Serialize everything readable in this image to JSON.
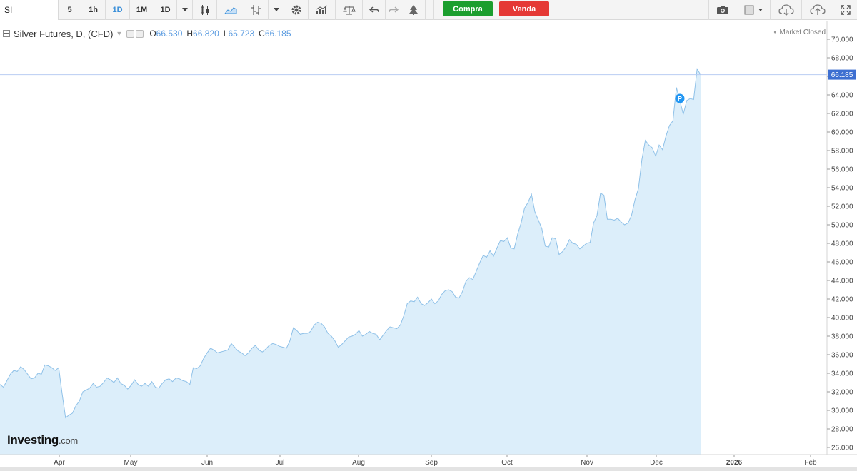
{
  "toolbar": {
    "symbol": "SI",
    "intervals": [
      "5",
      "1h",
      "1D",
      "1M",
      "1D"
    ],
    "active_interval_index": 2,
    "buy_label": "Compra",
    "sell_label": "Venda",
    "colors": {
      "buy": "#1b9e2e",
      "sell": "#e53935",
      "active": "#3a8fd9"
    }
  },
  "legend": {
    "title": "Silver Futures, D, (CFD)",
    "open_label": "O",
    "open_value": "66.530",
    "high_label": "H",
    "high_value": "66.820",
    "low_label": "L",
    "low_value": "65.723",
    "close_label": "C",
    "close_value": "66.185"
  },
  "status": {
    "market": "Market Closed"
  },
  "brand": {
    "name": "Investing",
    "suffix": ".com"
  },
  "chart_data": {
    "type": "area",
    "series": [
      {
        "values": [
          32.8,
          32.5,
          33.2,
          33.9,
          34.3,
          34.2,
          34.7,
          34.4,
          33.9,
          33.4,
          33.5,
          34.0,
          33.9,
          34.9,
          34.8,
          34.6,
          34.3,
          34.6,
          31.8,
          29.2,
          29.5,
          29.7,
          30.5,
          31.0,
          32.0,
          32.2,
          32.4,
          32.9,
          32.5,
          32.6,
          33.0,
          33.5,
          33.3,
          33.0,
          33.5,
          32.9,
          32.7,
          32.3,
          32.7,
          33.3,
          32.8,
          32.6,
          32.9,
          32.6,
          33.1,
          32.5,
          32.4,
          32.9,
          33.3,
          33.4,
          33.1,
          33.5,
          33.4,
          33.2,
          33.1,
          32.8,
          34.6,
          34.5,
          34.8,
          35.6,
          36.2,
          36.7,
          36.5,
          36.2,
          36.3,
          36.4,
          36.5,
          37.2,
          36.8,
          36.4,
          36.2,
          35.9,
          36.2,
          36.7,
          37.0,
          36.5,
          36.3,
          36.6,
          37.0,
          37.2,
          37.1,
          36.9,
          36.8,
          36.7,
          37.5,
          38.9,
          38.6,
          38.2,
          38.3,
          38.3,
          38.5,
          39.2,
          39.5,
          39.4,
          39.0,
          38.3,
          38.0,
          37.5,
          36.8,
          37.1,
          37.5,
          37.9,
          38.0,
          38.2,
          38.6,
          38.0,
          38.2,
          38.5,
          38.3,
          38.2,
          37.6,
          38.1,
          38.6,
          39.0,
          38.9,
          38.8,
          39.2,
          40.2,
          41.5,
          41.8,
          41.7,
          42.2,
          41.5,
          41.3,
          41.6,
          42.0,
          41.5,
          41.8,
          42.5,
          42.9,
          43.0,
          42.8,
          42.2,
          42.1,
          42.8,
          43.9,
          44.3,
          44.1,
          45.0,
          45.9,
          46.7,
          46.5,
          47.2,
          46.6,
          47.5,
          48.3,
          48.2,
          48.6,
          47.5,
          47.4,
          49.0,
          50.2,
          51.8,
          52.4,
          53.3,
          51.4,
          50.5,
          49.6,
          47.7,
          47.6,
          48.6,
          48.5,
          46.8,
          47.1,
          47.6,
          48.4,
          48.0,
          47.9,
          47.4,
          47.7,
          48.0,
          48.1,
          50.2,
          51.0,
          53.4,
          53.2,
          50.6,
          50.6,
          50.5,
          50.7,
          50.3,
          50.0,
          50.2,
          51.0,
          52.7,
          53.9,
          57.0,
          59.1,
          58.6,
          58.3,
          57.4,
          58.6,
          58.1,
          59.6,
          60.7,
          61.2,
          64.8,
          63.4,
          61.9,
          63.4,
          63.6,
          63.5,
          66.8,
          66.185
        ],
        "last_value": "66.185",
        "last_marker": "P"
      }
    ],
    "x_labels": [
      "Apr",
      "May",
      "Jun",
      "Jul",
      "Aug",
      "Sep",
      "Oct",
      "Nov",
      "Dec",
      "2026",
      "Feb"
    ],
    "y_ticks": [
      "26.000",
      "28.000",
      "30.000",
      "32.000",
      "34.000",
      "36.000",
      "38.000",
      "40.000",
      "42.000",
      "44.000",
      "46.000",
      "48.000",
      "50.000",
      "52.000",
      "54.000",
      "56.000",
      "58.000",
      "60.000",
      "62.000",
      "64.000",
      "66.000",
      "68.000",
      "70.000"
    ],
    "ylim": [
      25,
      71
    ],
    "colors": {
      "line": "#8fc1e8",
      "fill": "#dceefa",
      "price_label": "#3d6fd1",
      "marker": "#2196f3"
    }
  }
}
